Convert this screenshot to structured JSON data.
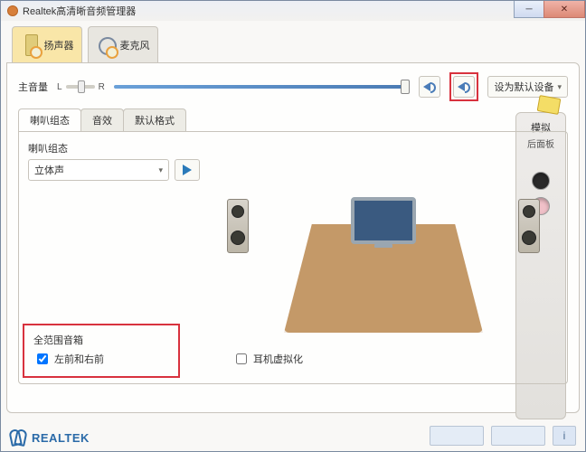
{
  "window": {
    "title": "Realtek高清晰音频管理器"
  },
  "tabs_top": [
    {
      "label": "扬声器",
      "active": true
    },
    {
      "label": "麦克风",
      "active": false
    }
  ],
  "master_volume": {
    "label": "主音量",
    "balance_left": "L",
    "balance_right": "R",
    "default_device_label": "设为默认设备"
  },
  "mimic": {
    "title": "模拟",
    "subtitle": "后面板"
  },
  "subtabs": [
    {
      "label": "喇叭组态",
      "active": true
    },
    {
      "label": "音效",
      "active": false
    },
    {
      "label": "默认格式",
      "active": false
    }
  ],
  "speaker_config": {
    "label": "喇叭组态",
    "dropdown_value": "立体声"
  },
  "full_range": {
    "title": "全范围音箱",
    "checkbox_label": "左前和右前",
    "checked": true
  },
  "virtualization": {
    "label": "耳机虚拟化",
    "checked": false
  },
  "footer": {
    "brand": "REALTEK"
  }
}
